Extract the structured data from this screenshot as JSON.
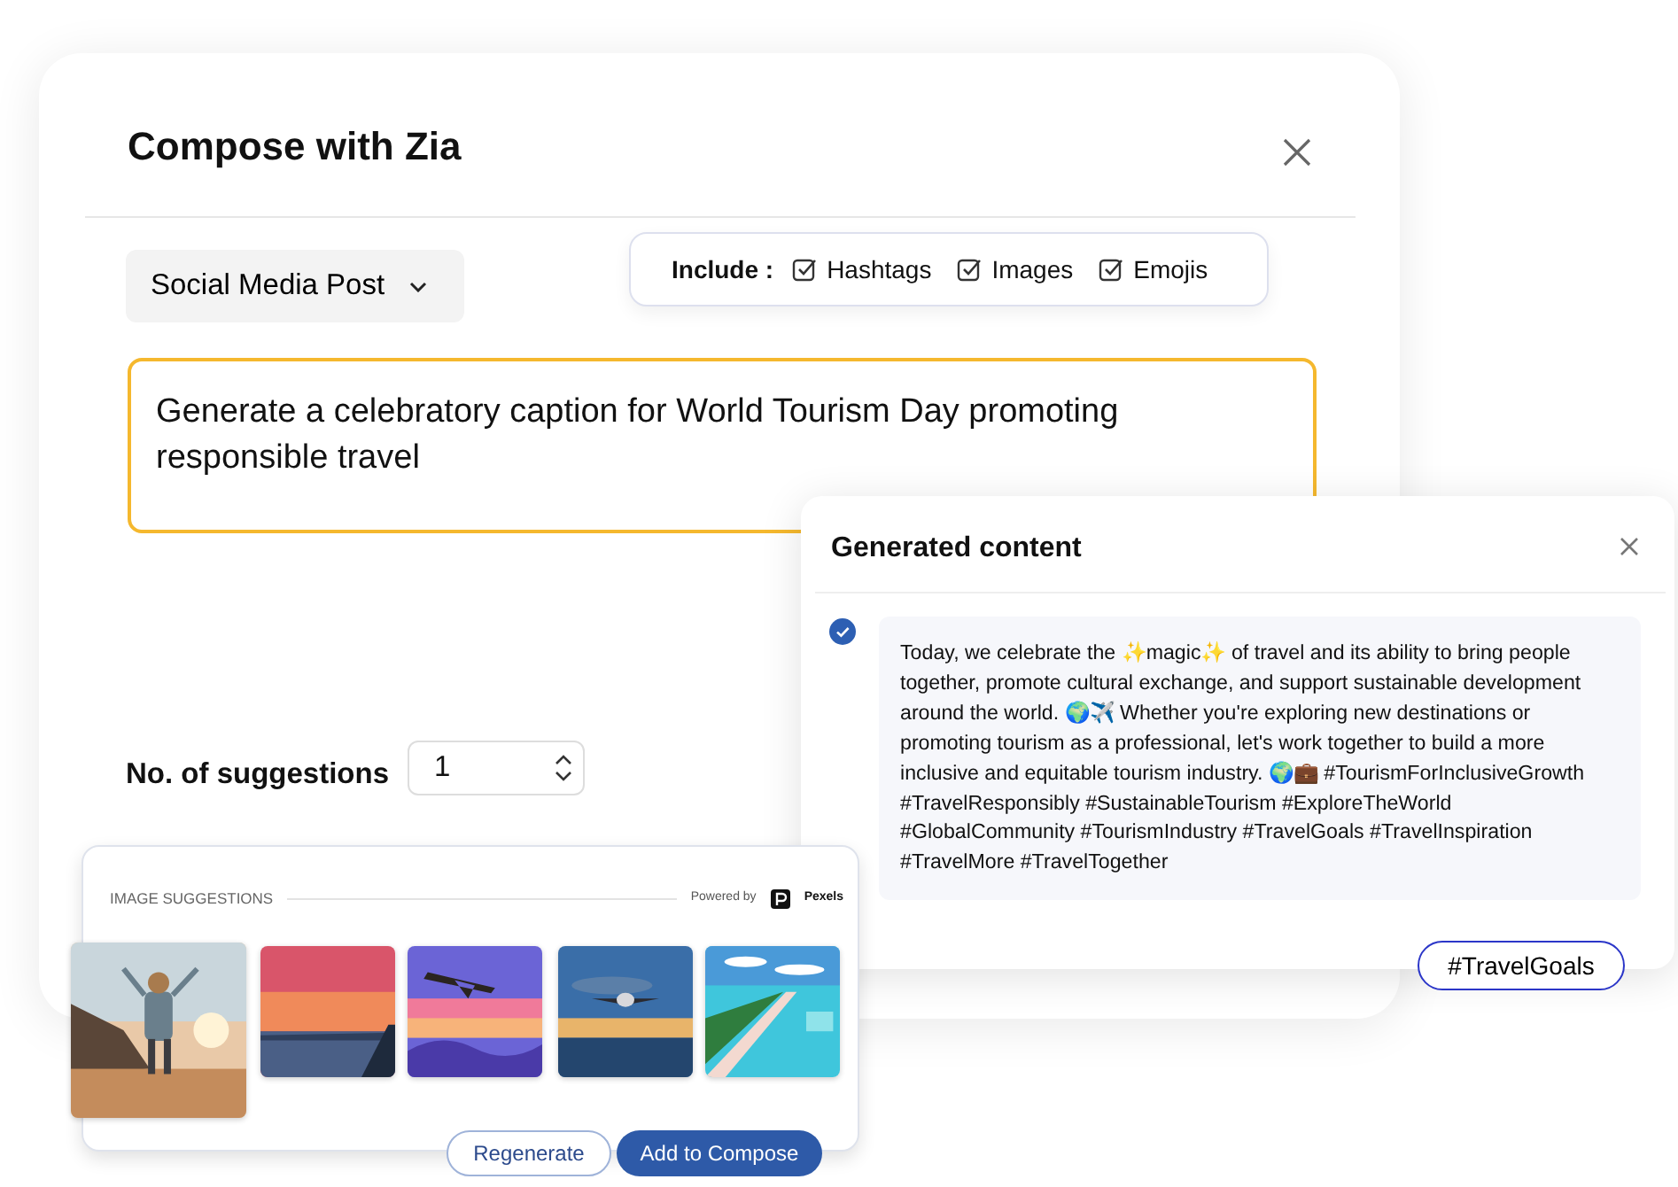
{
  "compose": {
    "title": "Compose with Zia",
    "post_type": "Social Media Post",
    "include": {
      "label": "Include :",
      "options": [
        {
          "label": "Hashtags",
          "checked": true
        },
        {
          "label": "Images",
          "checked": true
        },
        {
          "label": "Emojis",
          "checked": true
        }
      ]
    },
    "prompt": "Generate a celebratory caption for World Tourism Day promoting responsible travel",
    "suggestions": {
      "label": "No. of suggestions",
      "value": "1"
    }
  },
  "generated": {
    "title": "Generated content",
    "items": [
      {
        "text": "Today, we celebrate the ✨magic✨ of travel and its ability to bring people together, promote cultural exchange, and support sustainable development around the world. 🌍✈️ Whether you're exploring new destinations or promoting tourism as a professional, let's work together to build a more inclusive and equitable tourism industry. 🌍💼 #TourismForInclusiveGrowth #TravelResponsibly #SustainableTourism #ExploreTheWorld #GlobalCommunity #TourismIndustry #TravelGoals #TravelInspiration #TravelMore #TravelTogether",
        "selected": true
      }
    ],
    "tag": "#TravelGoals"
  },
  "image_suggestions": {
    "title": "IMAGE SUGGESTIONS",
    "powered_by": "Powered by",
    "provider": "Pexels",
    "images": [
      {
        "kind": "picture",
        "selected": true
      },
      {
        "kind": "picture",
        "selected": false
      },
      {
        "kind": "picture",
        "selected": false
      },
      {
        "kind": "picture",
        "selected": false
      },
      {
        "kind": "picture",
        "selected": false
      }
    ],
    "buttons": [
      {
        "label": "Regenerate",
        "kind": "outline"
      },
      {
        "label": "Add to Compose",
        "kind": "primary"
      }
    ]
  }
}
